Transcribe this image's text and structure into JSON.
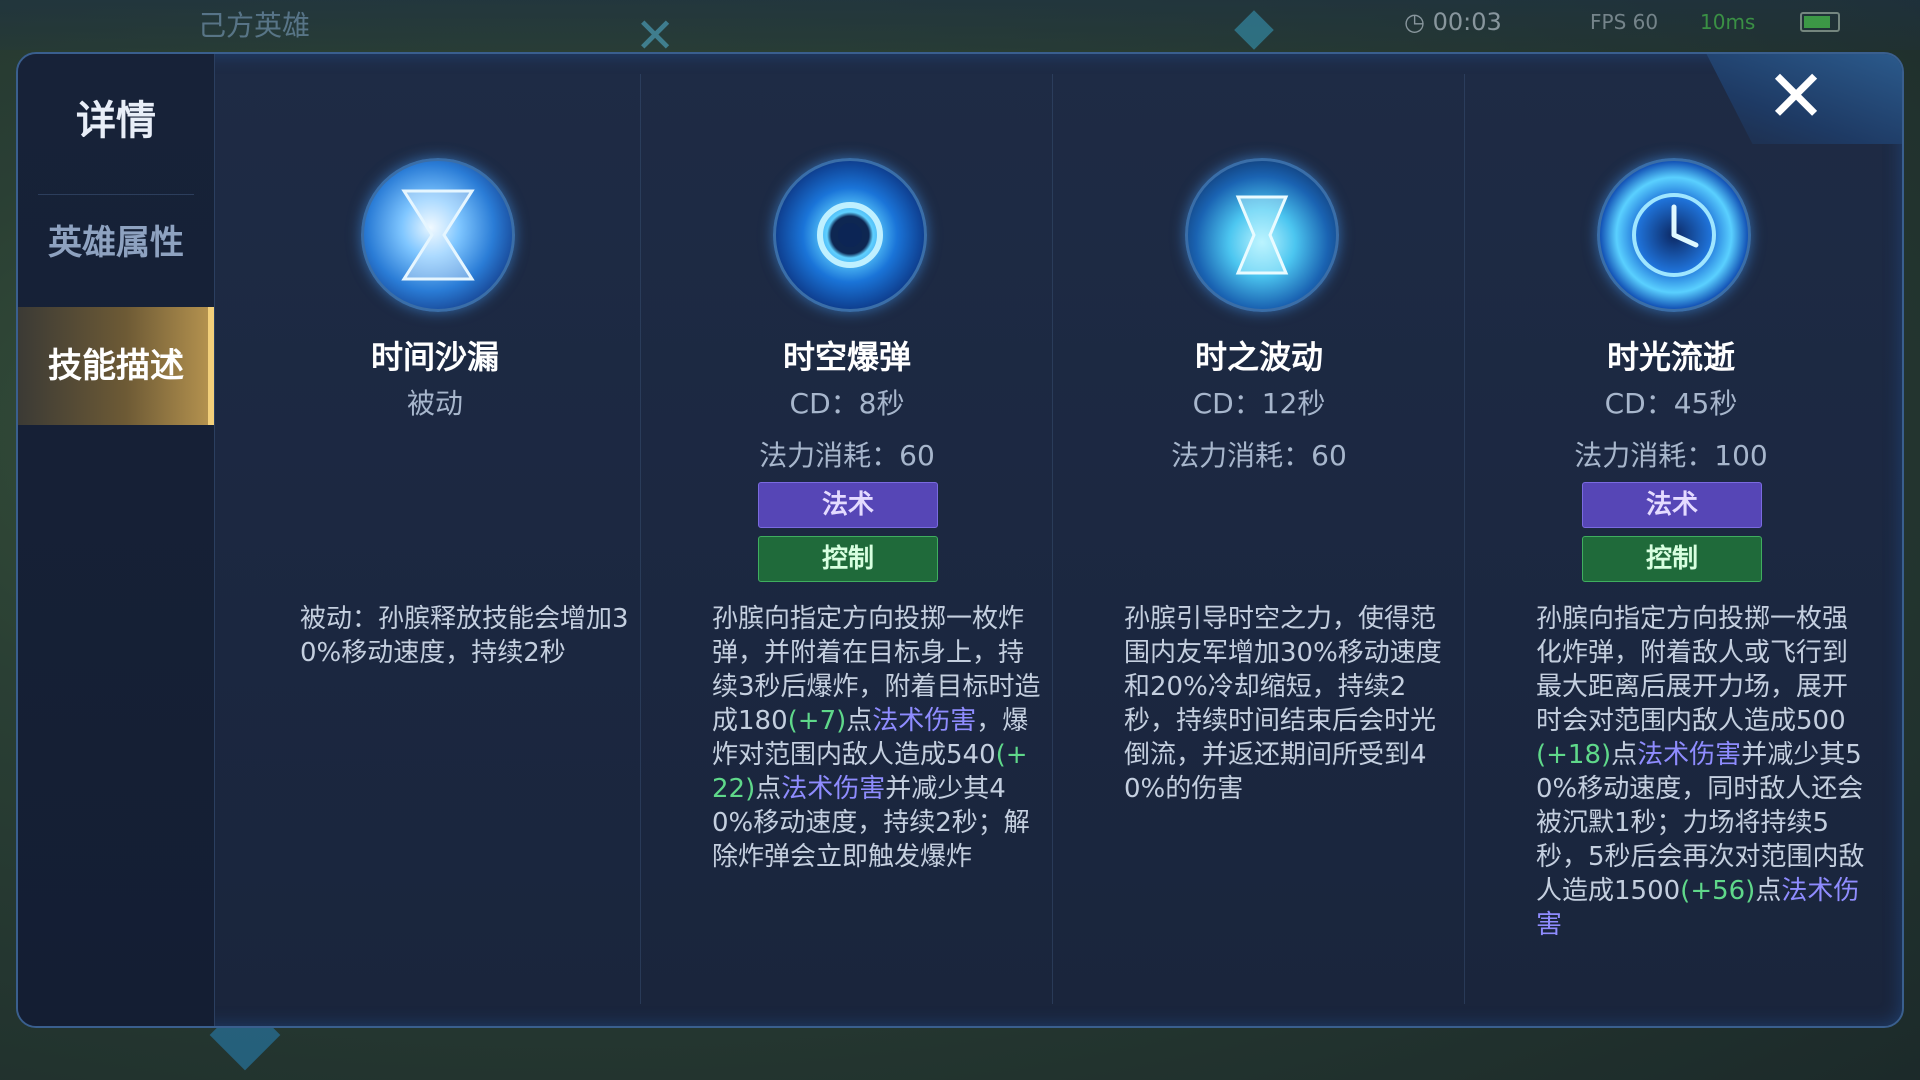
{
  "background": {
    "team_title": "己方英雄",
    "timer": "00:03",
    "fps": "FPS 60",
    "ping": "10ms"
  },
  "panel": {
    "title": "详情",
    "tabs": [
      {
        "label": "英雄属性",
        "active": false
      },
      {
        "label": "技能描述",
        "active": true
      }
    ],
    "close_icon": "close-icon"
  },
  "skills": [
    {
      "icon": "hourglass-icon",
      "name": "时间沙漏",
      "line1": "被动",
      "line2": "",
      "tags": [],
      "desc": [
        {
          "text": "被动：孙膑释放技能会增加30%移动速度，持续2秒",
          "style": "normal"
        }
      ]
    },
    {
      "icon": "time-bomb-icon",
      "name": "时空爆弹",
      "line1": "CD：8秒",
      "line2": "法力消耗：60",
      "tags": [
        "法术",
        "控制"
      ],
      "desc": [
        {
          "text": "孙膑向指定方向投掷一枚炸弹，并附着在目标身上，持续3秒后爆炸，附着目标时造成180",
          "style": "normal"
        },
        {
          "text": "(+7)",
          "style": "green"
        },
        {
          "text": "点",
          "style": "normal"
        },
        {
          "text": "法术伤害",
          "style": "purple"
        },
        {
          "text": "，爆炸对范围内敌人造成540",
          "style": "normal"
        },
        {
          "text": "(+22)",
          "style": "green"
        },
        {
          "text": "点",
          "style": "normal"
        },
        {
          "text": "法术伤害",
          "style": "purple"
        },
        {
          "text": "并减少其40%移动速度，持续2秒；解除炸弹会立即触发爆炸",
          "style": "normal"
        }
      ]
    },
    {
      "icon": "time-wave-icon",
      "name": "时之波动",
      "line1": "CD：12秒",
      "line2": "法力消耗：60",
      "tags": [],
      "desc": [
        {
          "text": "孙膑引导时空之力，使得范围内友军增加30%移动速度和20%冷却缩短，持续2秒，持续时间结束后会时光倒流，并返还期间所受到40%的伤害",
          "style": "normal"
        }
      ]
    },
    {
      "icon": "time-flow-icon",
      "name": "时光流逝",
      "line1": "CD：45秒",
      "line2": "法力消耗：100",
      "tags": [
        "法术",
        "控制"
      ],
      "desc": [
        {
          "text": "孙膑向指定方向投掷一枚强化炸弹，附着敌人或飞行到最大距离后展开力场，展开时会对范围内敌人造成500",
          "style": "normal"
        },
        {
          "text": "(+18)",
          "style": "green"
        },
        {
          "text": "点",
          "style": "normal"
        },
        {
          "text": "法术伤害",
          "style": "purple"
        },
        {
          "text": "并减少其50%移动速度，同时敌人还会被沉默1秒；力场将持续5秒，5秒后会再次对范围内敌人造成1500",
          "style": "normal"
        },
        {
          "text": "(+56)",
          "style": "green"
        },
        {
          "text": "点",
          "style": "normal"
        },
        {
          "text": "法术伤害",
          "style": "purple"
        }
      ]
    }
  ]
}
